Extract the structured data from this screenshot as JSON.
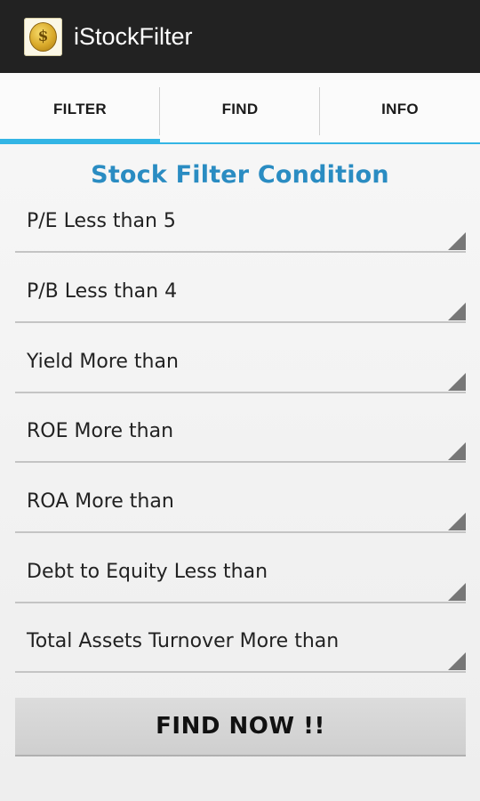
{
  "app": {
    "title": "iStockFilter",
    "icon": "coin-dollar-icon",
    "icon_glyph": "$"
  },
  "tabs": [
    {
      "label": "FILTER",
      "selected": true
    },
    {
      "label": "FIND",
      "selected": false
    },
    {
      "label": "INFO",
      "selected": false
    }
  ],
  "section_title": "Stock Filter Condition",
  "filters": [
    {
      "label": "P/E Less than 5"
    },
    {
      "label": "P/B Less than 4"
    },
    {
      "label": "Yield More than"
    },
    {
      "label": "ROE More than"
    },
    {
      "label": "ROA More than"
    },
    {
      "label": "Debt to Equity Less than"
    },
    {
      "label": "Total Assets Turnover More than"
    }
  ],
  "find_button": {
    "label": "FIND NOW !!"
  },
  "colors": {
    "action_bar": "#222222",
    "accent": "#33b5e5",
    "title_blue": "#2a8cc2"
  }
}
